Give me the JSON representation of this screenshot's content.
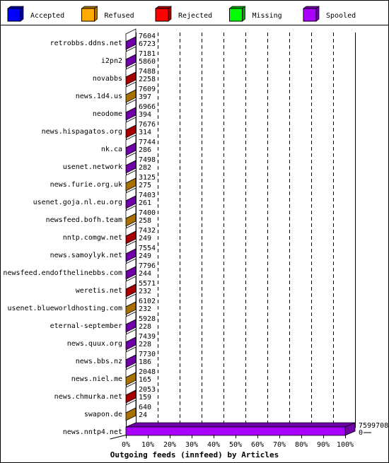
{
  "chart_data": {
    "type": "bar",
    "orientation": "horizontal",
    "style": "3d-stacked",
    "title": "Outgoing feeds (innfeed) by Articles",
    "legend_position": "top",
    "legend": [
      {
        "name": "Accepted",
        "color": "#0000ff",
        "shade": "#0000a0"
      },
      {
        "name": "Refused",
        "color": "#ffaa00",
        "shade": "#a87000"
      },
      {
        "name": "Rejected",
        "color": "#ff0000",
        "shade": "#a80000"
      },
      {
        "name": "Missing",
        "color": "#00ff00",
        "shade": "#00a000"
      },
      {
        "name": "Spooled",
        "color": "#aa00ff",
        "shade": "#7000a8"
      }
    ],
    "xlim": [
      0,
      100
    ],
    "x_ticks": [
      "0%",
      "10%",
      "20%",
      "30%",
      "40%",
      "50%",
      "60%",
      "70%",
      "80%",
      "90%",
      "100%"
    ],
    "grid": true,
    "rows": [
      {
        "name": "retrobbs.ddns.net",
        "top": "7604",
        "bottom": "6723",
        "category": "Spooled"
      },
      {
        "name": "i2pn2",
        "top": "7181",
        "bottom": "5860",
        "category": "Spooled"
      },
      {
        "name": "novabbs",
        "top": "7488",
        "bottom": "2258",
        "category": "Rejected"
      },
      {
        "name": "news.1d4.us",
        "top": "7609",
        "bottom": "397",
        "category": "Refused"
      },
      {
        "name": "neodome",
        "top": "6966",
        "bottom": "394",
        "category": "Spooled"
      },
      {
        "name": "news.hispagatos.org",
        "top": "7676",
        "bottom": "314",
        "category": "Rejected"
      },
      {
        "name": "nk.ca",
        "top": "7744",
        "bottom": "286",
        "category": "Spooled"
      },
      {
        "name": "usenet.network",
        "top": "7498",
        "bottom": "282",
        "category": "Spooled"
      },
      {
        "name": "news.furie.org.uk",
        "top": "3125",
        "bottom": "275",
        "category": "Refused"
      },
      {
        "name": "usenet.goja.nl.eu.org",
        "top": "7403",
        "bottom": "261",
        "category": "Spooled"
      },
      {
        "name": "newsfeed.bofh.team",
        "top": "7400",
        "bottom": "258",
        "category": "Refused"
      },
      {
        "name": "nntp.comgw.net",
        "top": "7432",
        "bottom": "249",
        "category": "Rejected"
      },
      {
        "name": "news.samoylyk.net",
        "top": "7554",
        "bottom": "249",
        "category": "Spooled"
      },
      {
        "name": "newsfeed.endofthelinebbs.com",
        "top": "7796",
        "bottom": "244",
        "category": "Spooled"
      },
      {
        "name": "weretis.net",
        "top": "5571",
        "bottom": "232",
        "category": "Rejected"
      },
      {
        "name": "usenet.blueworldhosting.com",
        "top": "6102",
        "bottom": "232",
        "category": "Refused"
      },
      {
        "name": "eternal-september",
        "top": "5928",
        "bottom": "228",
        "category": "Spooled"
      },
      {
        "name": "news.quux.org",
        "top": "7439",
        "bottom": "228",
        "category": "Spooled"
      },
      {
        "name": "news.bbs.nz",
        "top": "7730",
        "bottom": "186",
        "category": "Spooled"
      },
      {
        "name": "news.niel.me",
        "top": "2048",
        "bottom": "165",
        "category": "Refused"
      },
      {
        "name": "news.chmurka.net",
        "top": "2053",
        "bottom": "159",
        "category": "Rejected"
      },
      {
        "name": "swapon.de",
        "top": "640",
        "bottom": "24",
        "category": "Refused"
      },
      {
        "name": "news.nntp4.net",
        "top": "7599708",
        "bottom": "0",
        "category": "Spooled",
        "percent": 100
      }
    ]
  }
}
